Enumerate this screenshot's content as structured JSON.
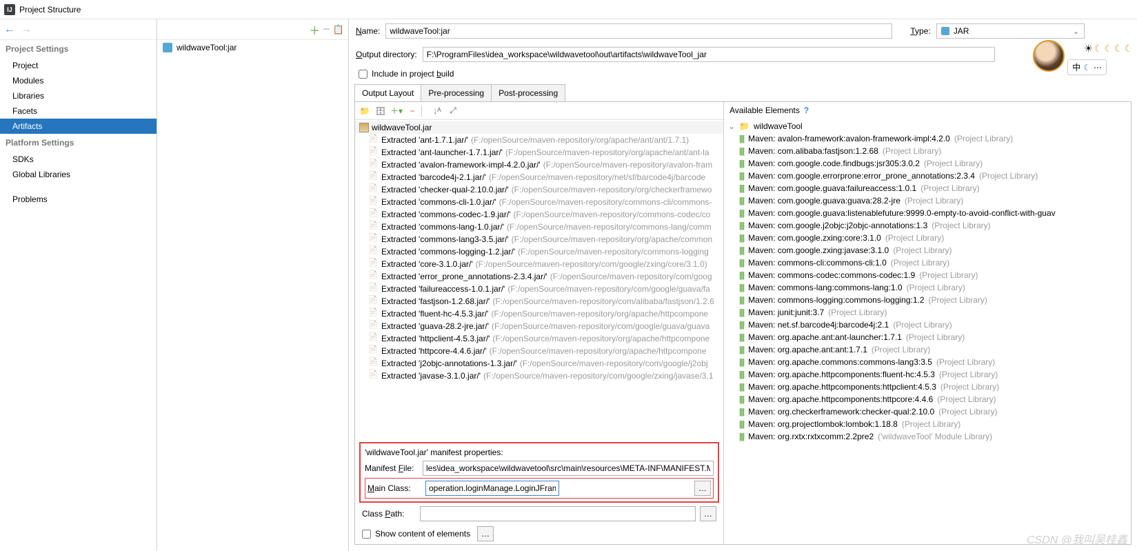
{
  "window": {
    "title": "Project Structure"
  },
  "sidebar": {
    "projectSettings": "Project Settings",
    "platformSettings": "Platform Settings",
    "items": {
      "project": "Project",
      "modules": "Modules",
      "libraries": "Libraries",
      "facets": "Facets",
      "artifacts": "Artifacts",
      "sdks": "SDKs",
      "globalLibraries": "Global Libraries",
      "problems": "Problems"
    }
  },
  "artifact_tree": {
    "item": "wildwaveTool:jar"
  },
  "form": {
    "nameLabel": "Name:",
    "nameValue": "wildwaveTool:jar",
    "typeLabel": "Type:",
    "typeValue": "JAR",
    "outDirLabel": "Output directory:",
    "outDirValue": "F:\\ProgramFiles\\idea_workspace\\wildwavetool\\out\\artifacts\\wildwaveTool_jar",
    "includeLabel": "Include in project build"
  },
  "tabs": {
    "outputLayout": "Output Layout",
    "preProcessing": "Pre-processing",
    "postProcessing": "Post-processing"
  },
  "layout": {
    "root": "wildwaveTool.jar",
    "rows": [
      {
        "n": "Extracted 'ant-1.7.1.jar/'",
        "p": "(F:/openSource/maven-repository/org/apache/ant/ant/1.7.1)"
      },
      {
        "n": "Extracted 'ant-launcher-1.7.1.jar/'",
        "p": "(F:/openSource/maven-repository/org/apache/ant/ant-la"
      },
      {
        "n": "Extracted 'avalon-framework-impl-4.2.0.jar/'",
        "p": "(F:/openSource/maven-repository/avalon-fram"
      },
      {
        "n": "Extracted 'barcode4j-2.1.jar/'",
        "p": "(F:/openSource/maven-repository/net/sf/barcode4j/barcode"
      },
      {
        "n": "Extracted 'checker-qual-2.10.0.jar/'",
        "p": "(F:/openSource/maven-repository/org/checkerframewo"
      },
      {
        "n": "Extracted 'commons-cli-1.0.jar/'",
        "p": "(F:/openSource/maven-repository/commons-cli/commons-"
      },
      {
        "n": "Extracted 'commons-codec-1.9.jar/'",
        "p": "(F:/openSource/maven-repository/commons-codec/co"
      },
      {
        "n": "Extracted 'commons-lang-1.0.jar/'",
        "p": "(F:/openSource/maven-repository/commons-lang/comm"
      },
      {
        "n": "Extracted 'commons-lang3-3.5.jar/'",
        "p": "(F:/openSource/maven-repository/org/apache/common"
      },
      {
        "n": "Extracted 'commons-logging-1.2.jar/'",
        "p": "(F:/openSource/maven-repository/commons-logging"
      },
      {
        "n": "Extracted 'core-3.1.0.jar/'",
        "p": "(F:/openSource/maven-repository/com/google/zxing/core/3.1.0)"
      },
      {
        "n": "Extracted 'error_prone_annotations-2.3.4.jar/'",
        "p": "(F:/openSource/maven-repository/com/goog"
      },
      {
        "n": "Extracted 'failureaccess-1.0.1.jar/'",
        "p": "(F:/openSource/maven-repository/com/google/guava/fa"
      },
      {
        "n": "Extracted 'fastjson-1.2.68.jar/'",
        "p": "(F:/openSource/maven-repository/com/alibaba/fastjson/1.2.6"
      },
      {
        "n": "Extracted 'fluent-hc-4.5.3.jar/'",
        "p": "(F:/openSource/maven-repository/org/apache/httpcompone"
      },
      {
        "n": "Extracted 'guava-28.2-jre.jar/'",
        "p": "(F:/openSource/maven-repository/com/google/guava/guava"
      },
      {
        "n": "Extracted 'httpclient-4.5.3.jar/'",
        "p": "(F:/openSource/maven-repository/org/apache/httpcompone"
      },
      {
        "n": "Extracted 'httpcore-4.4.6.jar/'",
        "p": "(F:/openSource/maven-repository/org/apache/httpcompone"
      },
      {
        "n": "Extracted 'j2objc-annotations-1.3.jar/'",
        "p": "(F:/openSource/maven-repository/com/google/j2obj"
      },
      {
        "n": "Extracted 'javase-3.1.0.jar/'",
        "p": "(F:/openSource/maven-repository/com/google/zxing/javase/3.1"
      }
    ]
  },
  "manifest": {
    "heading": "'wildwaveTool.jar' manifest properties:",
    "fileLabel": "Manifest File:",
    "fileValue": "les\\idea_workspace\\wildwavetool\\src\\main\\resources\\META-INF\\MANIFEST.MF",
    "mainLabel": "Main Class:",
    "mainValue": "operation.loginManage.LoginJFrame",
    "classPathLabel": "Class Path:",
    "classPathValue": "",
    "showContentLabel": "Show content of elements"
  },
  "available": {
    "heading": "Available Elements",
    "root": "wildwaveTool",
    "rows": [
      {
        "n": "Maven: avalon-framework:avalon-framework-impl:4.2.0",
        "s": "(Project Library)"
      },
      {
        "n": "Maven: com.alibaba:fastjson:1.2.68",
        "s": "(Project Library)"
      },
      {
        "n": "Maven: com.google.code.findbugs:jsr305:3.0.2",
        "s": "(Project Library)"
      },
      {
        "n": "Maven: com.google.errorprone:error_prone_annotations:2.3.4",
        "s": "(Project Library)"
      },
      {
        "n": "Maven: com.google.guava:failureaccess:1.0.1",
        "s": "(Project Library)"
      },
      {
        "n": "Maven: com.google.guava:guava:28.2-jre",
        "s": "(Project Library)"
      },
      {
        "n": "Maven: com.google.guava:listenablefuture:9999.0-empty-to-avoid-conflict-with-guav",
        "s": ""
      },
      {
        "n": "Maven: com.google.j2objc:j2objc-annotations:1.3",
        "s": "(Project Library)"
      },
      {
        "n": "Maven: com.google.zxing:core:3.1.0",
        "s": "(Project Library)"
      },
      {
        "n": "Maven: com.google.zxing:javase:3.1.0",
        "s": "(Project Library)"
      },
      {
        "n": "Maven: commons-cli:commons-cli:1.0",
        "s": "(Project Library)"
      },
      {
        "n": "Maven: commons-codec:commons-codec:1.9",
        "s": "(Project Library)"
      },
      {
        "n": "Maven: commons-lang:commons-lang:1.0",
        "s": "(Project Library)"
      },
      {
        "n": "Maven: commons-logging:commons-logging:1.2",
        "s": "(Project Library)"
      },
      {
        "n": "Maven: junit:junit:3.7",
        "s": "(Project Library)"
      },
      {
        "n": "Maven: net.sf.barcode4j:barcode4j:2.1",
        "s": "(Project Library)"
      },
      {
        "n": "Maven: org.apache.ant:ant-launcher:1.7.1",
        "s": "(Project Library)"
      },
      {
        "n": "Maven: org.apache.ant:ant:1.7.1",
        "s": "(Project Library)"
      },
      {
        "n": "Maven: org.apache.commons:commons-lang3:3.5",
        "s": "(Project Library)"
      },
      {
        "n": "Maven: org.apache.httpcomponents:fluent-hc:4.5.3",
        "s": "(Project Library)"
      },
      {
        "n": "Maven: org.apache.httpcomponents:httpclient:4.5.3",
        "s": "(Project Library)"
      },
      {
        "n": "Maven: org.apache.httpcomponents:httpcore:4.4.6",
        "s": "(Project Library)"
      },
      {
        "n": "Maven: org.checkerframework:checker-qual:2.10.0",
        "s": "(Project Library)"
      },
      {
        "n": "Maven: org.projectlombok:lombok:1.18.8",
        "s": "(Project Library)"
      },
      {
        "n": "Maven: org.rxtx:rxtxcomm:2.2pre2",
        "s": "('wildwaveTool' Module Library)"
      }
    ]
  },
  "overlay": {
    "lang": "中",
    "watermark": "CSDN @我叫吴桂鑫"
  }
}
